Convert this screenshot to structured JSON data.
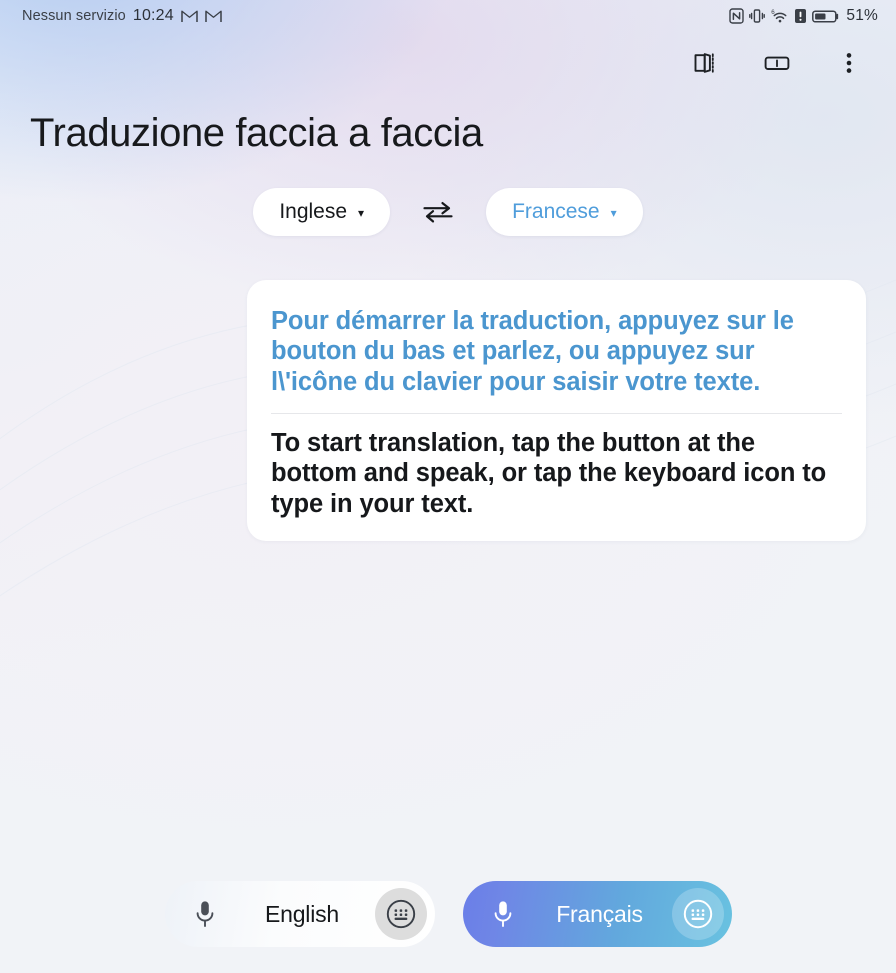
{
  "statusbar": {
    "carrier": "Nessun servizio",
    "time": "10:24",
    "app_icon_1": "gmail-icon",
    "app_icon_2": "gmail-icon",
    "nfc_icon": "nfc-icon",
    "vibrate_icon": "vibrate-icon",
    "wifi_icon": "wifi-6-icon",
    "wifi_label": "6",
    "sim_alert_icon": "sim-alert-icon",
    "battery_icon": "battery-icon",
    "battery_label": "51%"
  },
  "topbar": {
    "flex_mode_icon": "flex-mode-book-icon",
    "split_screen_icon": "split-screen-icon",
    "overflow_icon": "more-vertical-icon"
  },
  "header": {
    "title": "Traduzione faccia a faccia"
  },
  "language_selector": {
    "source_label": "Inglese",
    "source_color": "#17191c",
    "target_label": "Francese",
    "target_color": "#4f9ddb",
    "caret_glyph": "▾",
    "swap_icon": "swap-horizontal-icon"
  },
  "card": {
    "translated_text": "Pour démarrer la traduction, appuyez sur le bouton du bas et parlez, ou appuyez sur l\\'icône du clavier pour saisir votre texte.",
    "translated_color": "#4b96cf",
    "source_text": "To start translation, tap the button at the bottom and speak, or tap the keyboard icon to type in your text.",
    "source_color": "#16181b"
  },
  "bottom_bar": {
    "source_button": {
      "label": "English",
      "mic_icon": "microphone-icon",
      "keyboard_icon": "keyboard-icon",
      "background": "#ffffff"
    },
    "target_button": {
      "label": "Français",
      "mic_icon": "microphone-icon",
      "keyboard_icon": "keyboard-icon",
      "gradient_from": "#6a7ee8",
      "gradient_to": "#69c2e0"
    }
  }
}
